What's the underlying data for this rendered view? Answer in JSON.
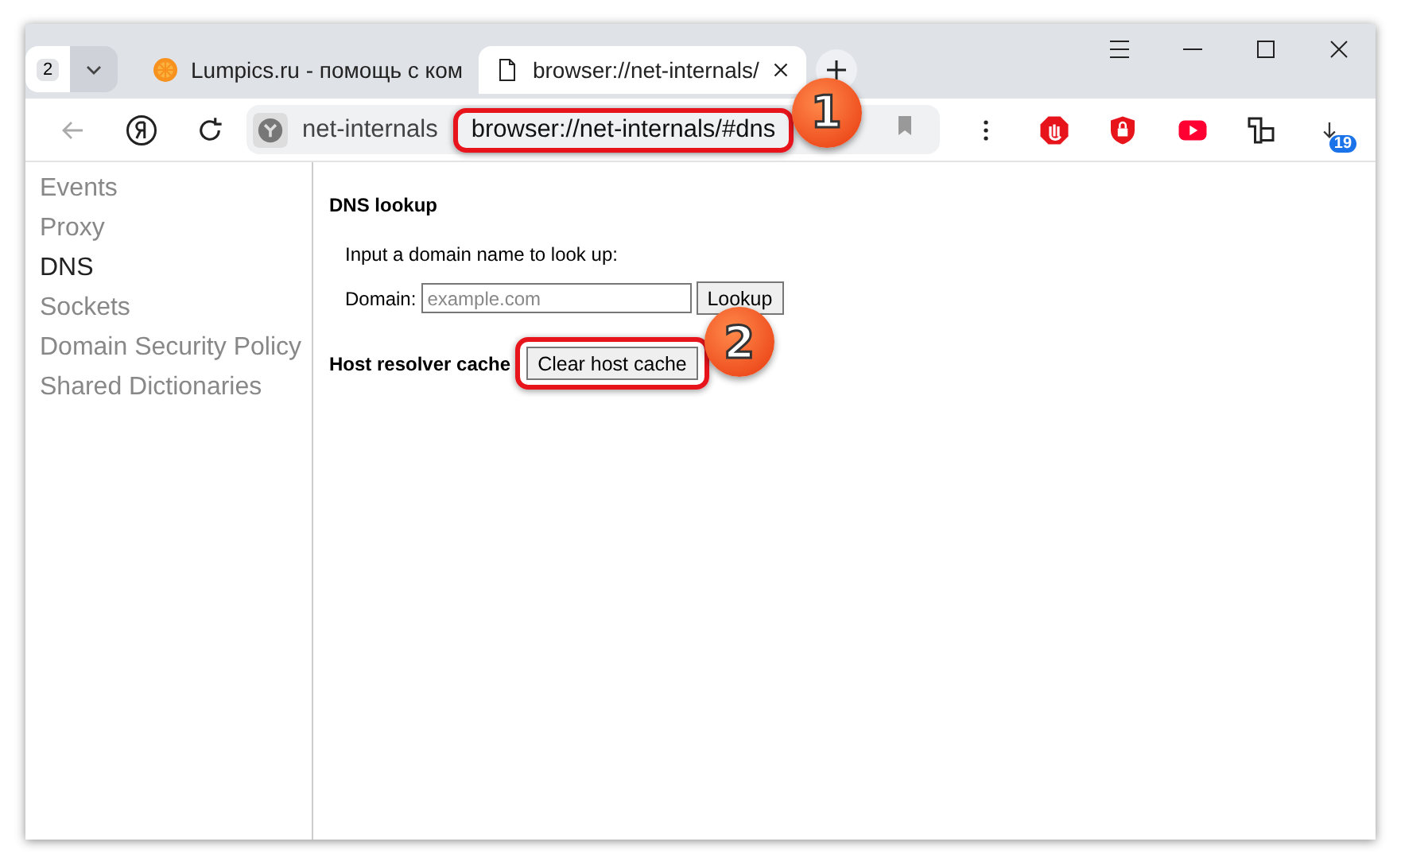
{
  "tab_strip": {
    "tab_count": "2",
    "tabs": [
      {
        "title": "Lumpics.ru - помощь с ком",
        "selected": false,
        "kind": "site"
      },
      {
        "title": "browser://net-internals/",
        "selected": true,
        "kind": "page"
      }
    ]
  },
  "address_bar": {
    "site_label": "net-internals",
    "url": "browser://net-internals/#dns"
  },
  "extensions": {
    "badge": "19"
  },
  "sidebar": {
    "items": [
      {
        "label": "Events",
        "selected": false
      },
      {
        "label": "Proxy",
        "selected": false
      },
      {
        "label": "DNS",
        "selected": true
      },
      {
        "label": "Sockets",
        "selected": false
      },
      {
        "label": "Domain Security Policy",
        "selected": false
      },
      {
        "label": "Shared Dictionaries",
        "selected": false
      }
    ]
  },
  "dns": {
    "title": "DNS lookup",
    "prompt": "Input a domain name to look up:",
    "domain_label": "Domain:",
    "placeholder": "example.com",
    "lookup_button": "Lookup",
    "cache_label": "Host resolver cache",
    "clear_button": "Clear host cache"
  },
  "callouts": [
    "1",
    "2"
  ]
}
